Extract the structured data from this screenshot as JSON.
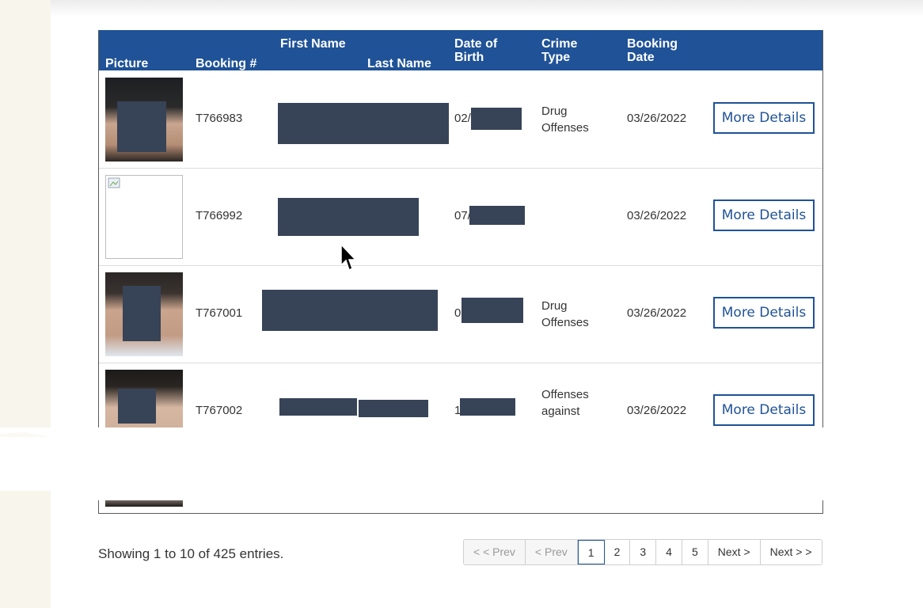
{
  "table": {
    "headers": {
      "picture": "Picture",
      "booking": "Booking #",
      "first_name": "First Name",
      "last_name": "Last Name",
      "dob": "Date of Birth",
      "crime_type": "Crime Type",
      "booking_date": "Booking Date"
    },
    "rows": [
      {
        "booking": "T766983",
        "dob_visible": "02/",
        "crime_1": "Drug",
        "crime_2": "Offenses",
        "date": "03/26/2022",
        "button": "More Details"
      },
      {
        "booking": "T766992",
        "dob_visible": "07/",
        "crime_1": "",
        "crime_2": "",
        "date": "03/26/2022",
        "button": "More Details"
      },
      {
        "booking": "T767001",
        "dob_visible": "0",
        "crime_1": "Drug",
        "crime_2": "Offenses",
        "date": "03/26/2022",
        "button": "More Details"
      },
      {
        "booking": "T767002",
        "dob_visible": "1",
        "crime_1": "Offenses",
        "crime_2": "against",
        "date": "03/26/2022",
        "button": "More Details"
      }
    ]
  },
  "footer": {
    "showing": "Showing 1 to 10 of 425 entries."
  },
  "pagination": {
    "first": "< < Prev",
    "prev": "< Prev",
    "pages": [
      "1",
      "2",
      "3",
      "4",
      "5"
    ],
    "next": "Next >",
    "last": "Next > >"
  },
  "colors": {
    "header_bg": "#1f5297",
    "redaction": "#374357"
  }
}
